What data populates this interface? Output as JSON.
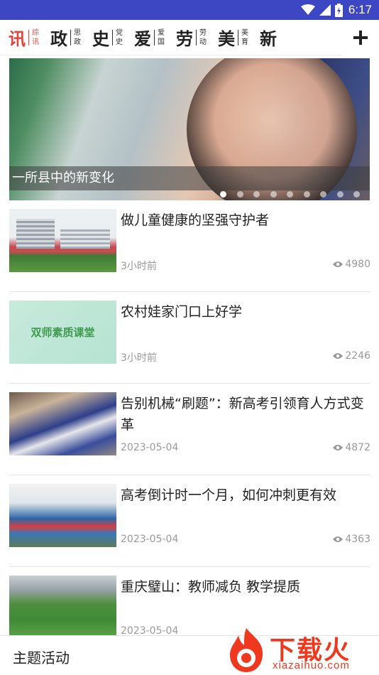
{
  "status_bar": {
    "time": "6:17",
    "icons": [
      "wifi-icon",
      "signal-icon",
      "battery-charging-icon"
    ]
  },
  "tabs": [
    {
      "big": "讯",
      "small": "综讯",
      "active": true
    },
    {
      "big": "政",
      "small": "思政",
      "active": false
    },
    {
      "big": "史",
      "small": "党史",
      "active": false
    },
    {
      "big": "爱",
      "small": "爱国",
      "active": false
    },
    {
      "big": "劳",
      "small": "劳动",
      "active": false
    },
    {
      "big": "美",
      "small": "美育",
      "active": false
    },
    {
      "big": "新",
      "small": "",
      "active": false
    }
  ],
  "add_tab_icon": "plus-icon",
  "banner": {
    "caption": "一所县中的新变化",
    "dot_count": 9,
    "active_dot": 0
  },
  "news": [
    {
      "title": "做儿童健康的坚强守护者",
      "time": "3小时前",
      "views": "4980",
      "thumb_text": ""
    },
    {
      "title": "农村娃家门口上好学",
      "time": "3小时前",
      "views": "2246",
      "thumb_text": "双师素质课堂"
    },
    {
      "title": "告别机械“刷题”：新高考引领育人方式变革",
      "time": "2023-05-04",
      "views": "4872",
      "thumb_text": ""
    },
    {
      "title": "高考倒计时一个月，如何冲刺更有效",
      "time": "2023-05-04",
      "views": "4363",
      "thumb_text": ""
    },
    {
      "title": "重庆璧山：教师减负 教学提质",
      "time": "2023-05-04",
      "views": "",
      "thumb_text": ""
    }
  ],
  "bottom_bar": {
    "label": "主题活动"
  },
  "watermark": {
    "brand": "下载火",
    "url": "xiazaihuo.com",
    "color": "#f0381e"
  }
}
